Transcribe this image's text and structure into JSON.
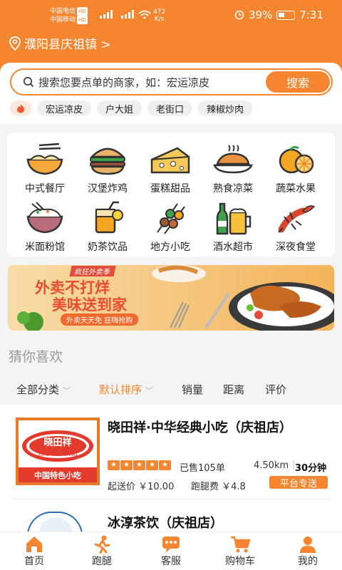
{
  "status_bar": {
    "carrier1": "中国电信",
    "carrier2": "中国移动",
    "hd_badge": "HD",
    "net_speed_value": "472",
    "net_speed_unit": "K/s",
    "battery": "39%",
    "time": "7:31"
  },
  "location": {
    "label": "濮阳县庆祖镇 >"
  },
  "search": {
    "placeholder": "搜索您要点单的商家，如：宏运凉皮",
    "button": "搜索"
  },
  "hot_keywords": [
    "宏运凉皮",
    "户大姐",
    "老街口",
    "辣椒炒肉"
  ],
  "categories": [
    {
      "label": "中式餐厅",
      "icon": "noodle-bowl-icon"
    },
    {
      "label": "汉堡炸鸡",
      "icon": "burger-icon"
    },
    {
      "label": "蛋糕甜品",
      "icon": "cheese-cake-icon"
    },
    {
      "label": "熟食凉菜",
      "icon": "roast-chicken-icon"
    },
    {
      "label": "蔬菜水果",
      "icon": "orange-fruit-icon"
    },
    {
      "label": "米面粉馆",
      "icon": "rice-bowl-icon"
    },
    {
      "label": "奶茶饮品",
      "icon": "milk-tea-icon"
    },
    {
      "label": "地方小吃",
      "icon": "skewer-icon"
    },
    {
      "label": "酒水超市",
      "icon": "beer-icon"
    },
    {
      "label": "深夜食堂",
      "icon": "lobster-icon"
    }
  ],
  "banner": {
    "tag": "疯狂外卖季",
    "line1": "外卖不打烊",
    "line2": "美味送到家",
    "sub": "外卖天天免 狂嗨抢购"
  },
  "section_title": "猜你喜欢",
  "sort_options": [
    {
      "label": "全部分类",
      "has_caret": true
    },
    {
      "label": "默认排序",
      "has_caret": true,
      "active": true
    },
    {
      "label": "销量"
    },
    {
      "label": "距离"
    },
    {
      "label": "评价"
    }
  ],
  "shops": [
    {
      "name": "晓田祥·中华经典小吃（庆祖店）",
      "logo_title": "晓田祥",
      "logo_sub": "XIAOTIANXIANG",
      "logo_bottom": "中国特色小吃",
      "rating_stars": 5,
      "sold": "已售105单",
      "distance": "4.50km",
      "eta": "30分钟",
      "min_order": "起送价 ￥10.00",
      "delivery_fee": "跑腿费 ￥4.8",
      "badge": "平台专送"
    },
    {
      "name": "冰淳茶饮（庆祖店）"
    }
  ],
  "tabbar": [
    {
      "label": "首页",
      "icon": "home-icon",
      "active": true
    },
    {
      "label": "跑腿",
      "icon": "runner-icon"
    },
    {
      "label": "客服",
      "icon": "chat-icon"
    },
    {
      "label": "购物车",
      "icon": "cart-icon"
    },
    {
      "label": "我的",
      "icon": "user-icon"
    }
  ],
  "colors": {
    "accent": "#f5852e",
    "accent_light": "#fde8dc",
    "background": "#f4f4f4"
  }
}
